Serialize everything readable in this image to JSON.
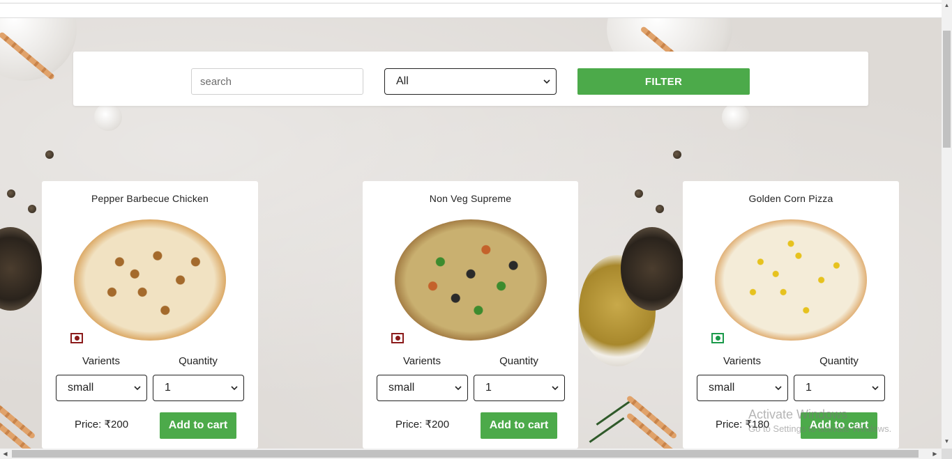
{
  "filter": {
    "search_placeholder": "search",
    "category_value": "All",
    "filter_label": "FILTER"
  },
  "labels": {
    "varients": "Varients",
    "quantity": "Quantity",
    "add_to_cart": "Add to cart"
  },
  "products": [
    {
      "name": "Pepper Barbecue Chicken",
      "variant": "small",
      "quantity": "1",
      "price": "Price: ₹200",
      "type": "non-veg",
      "mark_color": "#8b1a1a"
    },
    {
      "name": "Non Veg Supreme",
      "variant": "small",
      "quantity": "1",
      "price": "Price: ₹200",
      "type": "non-veg",
      "mark_color": "#8b1a1a"
    },
    {
      "name": "Golden Corn Pizza",
      "variant": "small",
      "quantity": "1",
      "price": "Price: ₹180",
      "type": "veg",
      "mark_color": "#1a9a4a"
    }
  ],
  "watermark": {
    "title": "Activate Windows",
    "subtitle": "Go to Settings to activate Windows."
  },
  "colors": {
    "accent_green": "#4caa4a"
  }
}
